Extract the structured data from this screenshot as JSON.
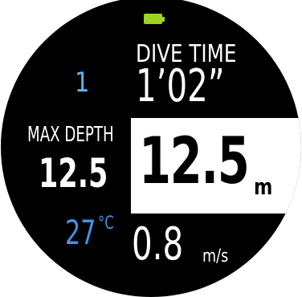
{
  "battery": {
    "icon": "battery-full-icon",
    "color": "#9cd420"
  },
  "dive_time": {
    "label": "DIVE TIME",
    "value": "1’02”"
  },
  "dive_number": {
    "value": "1",
    "color": "#5fb4f5"
  },
  "max_depth": {
    "label": "MAX DEPTH",
    "value": "12.5"
  },
  "depth": {
    "value": "12.5",
    "unit": "m"
  },
  "temperature": {
    "value": "27",
    "unit": "°C",
    "color": "#4a90e2"
  },
  "ascent_rate": {
    "value": "0.8",
    "unit": "m/s"
  },
  "colors": {
    "background": "#000000",
    "text": "#ffffff",
    "highlight_box": "#ffffff"
  }
}
